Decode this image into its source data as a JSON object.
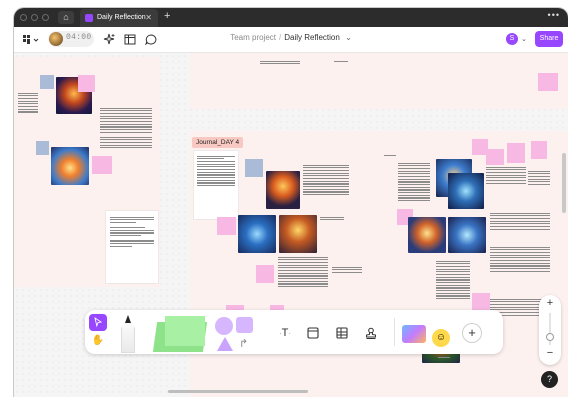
{
  "browser": {
    "tab_title": "Daily Reflection",
    "tab_close": "✕",
    "new_tab": "+",
    "more": "•••",
    "home_icon": "home-icon"
  },
  "toolbar": {
    "menu_icon": "figma-menu-icon",
    "timer": "04:00",
    "sparkle_icon": "ai-sparkle-icon",
    "layout_icon": "sidebar-layout-icon",
    "comment_icon": "comment-icon",
    "breadcrumb": {
      "project": "Team project",
      "separator": "/",
      "file": "Daily Reflection",
      "chevron": "⌄"
    },
    "user_initial": "S",
    "share_label": "Share"
  },
  "canvas": {
    "section_label": "Journal_DAY 4",
    "bg_color": "#f5f5f5",
    "section_color": "#fdf1ef",
    "sticky_pink": "#f8b8e4",
    "sticky_blue": "#a9bbd6"
  },
  "dock": {
    "pointer_icon": "pointer-icon",
    "hand_icon": "hand-icon",
    "text_tool": "T",
    "frame_icon": "frame-icon",
    "table_icon": "table-icon",
    "stamp_icon": "stamp-icon",
    "plus": "+"
  },
  "zoom": {
    "plus": "+",
    "minus": "−",
    "help": "?"
  },
  "colors": {
    "accent": "#9747ff",
    "titlebar": "#2c2c2c"
  }
}
